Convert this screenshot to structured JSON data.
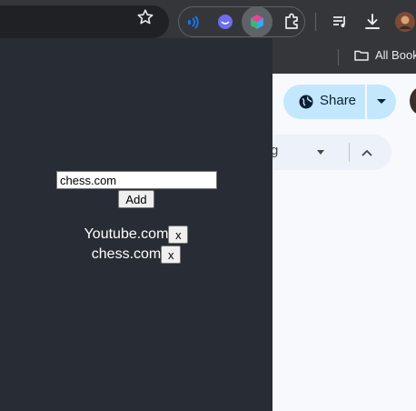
{
  "browser": {
    "toolbar": {
      "icons": [
        "bookmark-star-icon",
        "broadcast-extension-icon",
        "smiley-extension-icon",
        "cube-extension-icon",
        "extensions-puzzle-icon",
        "reading-list-icon",
        "download-icon",
        "profile-avatar"
      ]
    },
    "bookmarks_bar": {
      "all_bookmarks_label": "All Book"
    }
  },
  "page": {
    "share_label": "Share",
    "toolbar_fragment": "g"
  },
  "popup": {
    "input_value": "chess.com",
    "add_label": "Add",
    "sites": [
      {
        "name": "Youtube.com",
        "remove_label": "x"
      },
      {
        "name": "chess.com",
        "remove_label": "x"
      }
    ]
  },
  "colors": {
    "popup_bg": "#282c34",
    "toolbar_bg": "#35363a",
    "share_bg": "#c3e7fd",
    "page_bg": "#f8f9fc"
  }
}
